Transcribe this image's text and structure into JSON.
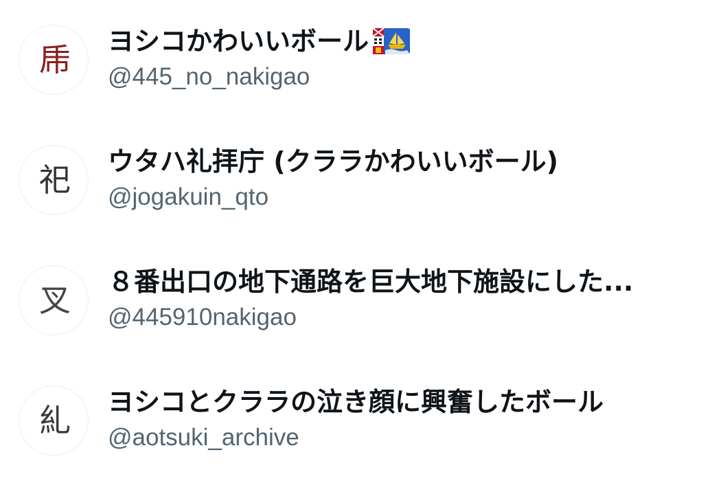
{
  "accounts": [
    {
      "display_name": "ヨシコかわいいボール",
      "handle": "@445_no_nakigao",
      "avatar_glyph": "乕",
      "avatar_color": "#8a1f1f",
      "emoji_icon": "saint-pierre-and-miquelon-flag-icon"
    },
    {
      "display_name": "ウタハ礼拝庁 (クララかわいいボール)",
      "handle": "@jogakuin_qto",
      "avatar_glyph": "祀",
      "avatar_color": "#333333"
    },
    {
      "display_name": "８番出口の地下通路を巨大地下施設にした...",
      "handle": "@445910nakigao",
      "avatar_glyph": "叉",
      "avatar_color": "#444444"
    },
    {
      "display_name": "ヨシコとクララの泣き顔に興奮したボール",
      "handle": "@aotsuki_archive",
      "avatar_glyph": "糺",
      "avatar_color": "#3a3a3a"
    }
  ],
  "colors": {
    "name": "#0f1419",
    "handle": "#536471",
    "background": "#ffffff"
  }
}
